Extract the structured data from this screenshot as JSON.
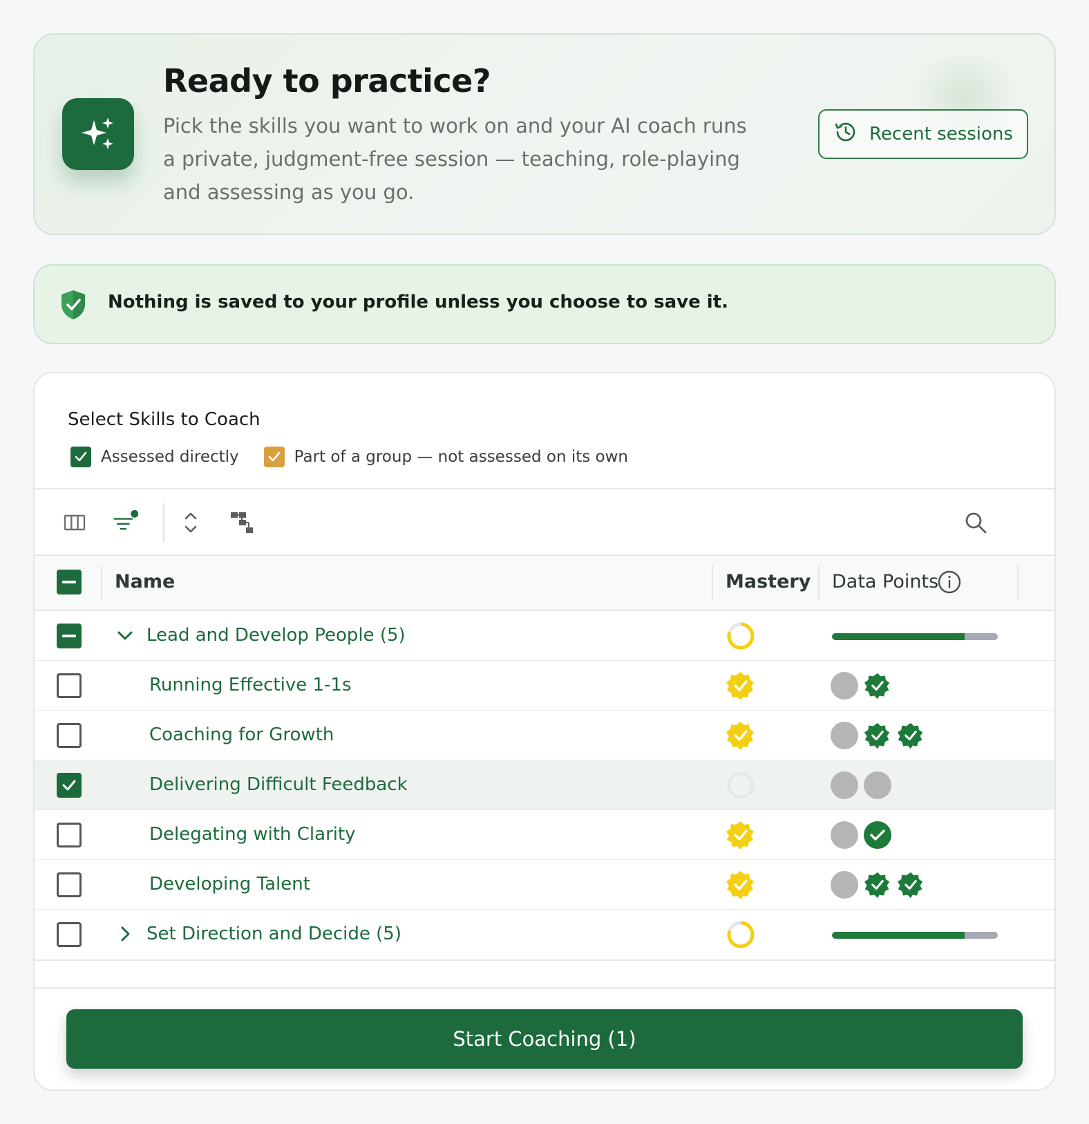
{
  "hero": {
    "title": "Ready to practice?",
    "description": "Pick the skills you want to work on and your AI coach runs a private, judgment-free session — teaching, role-playing and assessing as you go.",
    "recent_sessions_label": "Recent sessions"
  },
  "notice": {
    "text": "Nothing is saved to your profile unless you choose to save it."
  },
  "skills": {
    "title": "Select Skills to Coach",
    "legend": {
      "assessed_directly": "Assessed directly",
      "part_of_group": "Part of a group — not assessed on its own"
    },
    "columns": {
      "name": "Name",
      "mastery": "Mastery",
      "data_points": "Data Points"
    },
    "groups": [
      {
        "label": "Lead and Develop People (5)",
        "expanded": true,
        "selection": "indeterminate",
        "mastery": "partial",
        "data_points_fraction": 0.8,
        "skills": [
          {
            "label": "Running Effective 1-1s",
            "checked": false,
            "mastery": "achieved",
            "data_points": [
              "gray",
              "badge"
            ]
          },
          {
            "label": "Coaching for Growth",
            "checked": false,
            "mastery": "achieved",
            "data_points": [
              "gray",
              "badge",
              "badge"
            ]
          },
          {
            "label": "Delivering Difficult Feedback",
            "checked": true,
            "mastery": "none",
            "data_points": [
              "gray",
              "gray"
            ]
          },
          {
            "label": "Delegating with Clarity",
            "checked": false,
            "mastery": "achieved",
            "data_points": [
              "gray",
              "circle-check"
            ]
          },
          {
            "label": "Developing Talent",
            "checked": false,
            "mastery": "achieved",
            "data_points": [
              "gray",
              "badge",
              "badge"
            ]
          }
        ]
      },
      {
        "label": "Set Direction and Decide (5)",
        "expanded": false,
        "selection": "unchecked",
        "mastery": "partial",
        "data_points_fraction": 0.8
      }
    ],
    "start_button_label": "Start Coaching (1)"
  },
  "colors": {
    "brand_green": "#1d6b3c",
    "mastery_yellow": "#f5cf12",
    "legend_group": "#d9a040"
  },
  "icons": {
    "hero": "sparkles-icon",
    "recent": "history-icon",
    "notice": "shield-check-icon",
    "toolbar": [
      "columns-icon",
      "filter-icon",
      "expand-collapse-icon",
      "hierarchy-icon",
      "search-icon"
    ],
    "info": "info-icon"
  }
}
